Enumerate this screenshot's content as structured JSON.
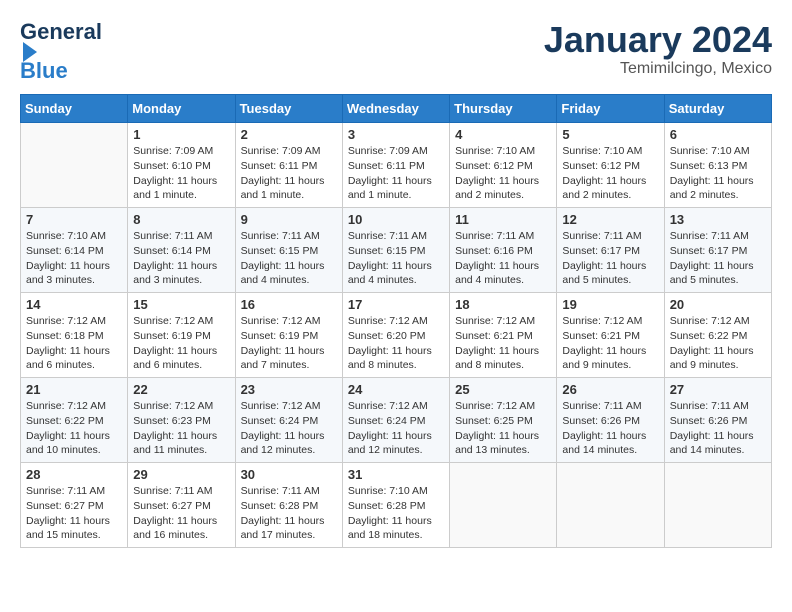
{
  "header": {
    "logo_line1": "General",
    "logo_line2": "Blue",
    "month_title": "January 2024",
    "location": "Temimilcingo, Mexico"
  },
  "days_of_week": [
    "Sunday",
    "Monday",
    "Tuesday",
    "Wednesday",
    "Thursday",
    "Friday",
    "Saturday"
  ],
  "weeks": [
    [
      {
        "day": "",
        "info": ""
      },
      {
        "day": "1",
        "info": "Sunrise: 7:09 AM\nSunset: 6:10 PM\nDaylight: 11 hours\nand 1 minute."
      },
      {
        "day": "2",
        "info": "Sunrise: 7:09 AM\nSunset: 6:11 PM\nDaylight: 11 hours\nand 1 minute."
      },
      {
        "day": "3",
        "info": "Sunrise: 7:09 AM\nSunset: 6:11 PM\nDaylight: 11 hours\nand 1 minute."
      },
      {
        "day": "4",
        "info": "Sunrise: 7:10 AM\nSunset: 6:12 PM\nDaylight: 11 hours\nand 2 minutes."
      },
      {
        "day": "5",
        "info": "Sunrise: 7:10 AM\nSunset: 6:12 PM\nDaylight: 11 hours\nand 2 minutes."
      },
      {
        "day": "6",
        "info": "Sunrise: 7:10 AM\nSunset: 6:13 PM\nDaylight: 11 hours\nand 2 minutes."
      }
    ],
    [
      {
        "day": "7",
        "info": "Sunrise: 7:10 AM\nSunset: 6:14 PM\nDaylight: 11 hours\nand 3 minutes."
      },
      {
        "day": "8",
        "info": "Sunrise: 7:11 AM\nSunset: 6:14 PM\nDaylight: 11 hours\nand 3 minutes."
      },
      {
        "day": "9",
        "info": "Sunrise: 7:11 AM\nSunset: 6:15 PM\nDaylight: 11 hours\nand 4 minutes."
      },
      {
        "day": "10",
        "info": "Sunrise: 7:11 AM\nSunset: 6:15 PM\nDaylight: 11 hours\nand 4 minutes."
      },
      {
        "day": "11",
        "info": "Sunrise: 7:11 AM\nSunset: 6:16 PM\nDaylight: 11 hours\nand 4 minutes."
      },
      {
        "day": "12",
        "info": "Sunrise: 7:11 AM\nSunset: 6:17 PM\nDaylight: 11 hours\nand 5 minutes."
      },
      {
        "day": "13",
        "info": "Sunrise: 7:11 AM\nSunset: 6:17 PM\nDaylight: 11 hours\nand 5 minutes."
      }
    ],
    [
      {
        "day": "14",
        "info": "Sunrise: 7:12 AM\nSunset: 6:18 PM\nDaylight: 11 hours\nand 6 minutes."
      },
      {
        "day": "15",
        "info": "Sunrise: 7:12 AM\nSunset: 6:19 PM\nDaylight: 11 hours\nand 6 minutes."
      },
      {
        "day": "16",
        "info": "Sunrise: 7:12 AM\nSunset: 6:19 PM\nDaylight: 11 hours\nand 7 minutes."
      },
      {
        "day": "17",
        "info": "Sunrise: 7:12 AM\nSunset: 6:20 PM\nDaylight: 11 hours\nand 8 minutes."
      },
      {
        "day": "18",
        "info": "Sunrise: 7:12 AM\nSunset: 6:21 PM\nDaylight: 11 hours\nand 8 minutes."
      },
      {
        "day": "19",
        "info": "Sunrise: 7:12 AM\nSunset: 6:21 PM\nDaylight: 11 hours\nand 9 minutes."
      },
      {
        "day": "20",
        "info": "Sunrise: 7:12 AM\nSunset: 6:22 PM\nDaylight: 11 hours\nand 9 minutes."
      }
    ],
    [
      {
        "day": "21",
        "info": "Sunrise: 7:12 AM\nSunset: 6:22 PM\nDaylight: 11 hours\nand 10 minutes."
      },
      {
        "day": "22",
        "info": "Sunrise: 7:12 AM\nSunset: 6:23 PM\nDaylight: 11 hours\nand 11 minutes."
      },
      {
        "day": "23",
        "info": "Sunrise: 7:12 AM\nSunset: 6:24 PM\nDaylight: 11 hours\nand 12 minutes."
      },
      {
        "day": "24",
        "info": "Sunrise: 7:12 AM\nSunset: 6:24 PM\nDaylight: 11 hours\nand 12 minutes."
      },
      {
        "day": "25",
        "info": "Sunrise: 7:12 AM\nSunset: 6:25 PM\nDaylight: 11 hours\nand 13 minutes."
      },
      {
        "day": "26",
        "info": "Sunrise: 7:11 AM\nSunset: 6:26 PM\nDaylight: 11 hours\nand 14 minutes."
      },
      {
        "day": "27",
        "info": "Sunrise: 7:11 AM\nSunset: 6:26 PM\nDaylight: 11 hours\nand 14 minutes."
      }
    ],
    [
      {
        "day": "28",
        "info": "Sunrise: 7:11 AM\nSunset: 6:27 PM\nDaylight: 11 hours\nand 15 minutes."
      },
      {
        "day": "29",
        "info": "Sunrise: 7:11 AM\nSunset: 6:27 PM\nDaylight: 11 hours\nand 16 minutes."
      },
      {
        "day": "30",
        "info": "Sunrise: 7:11 AM\nSunset: 6:28 PM\nDaylight: 11 hours\nand 17 minutes."
      },
      {
        "day": "31",
        "info": "Sunrise: 7:10 AM\nSunset: 6:28 PM\nDaylight: 11 hours\nand 18 minutes."
      },
      {
        "day": "",
        "info": ""
      },
      {
        "day": "",
        "info": ""
      },
      {
        "day": "",
        "info": ""
      }
    ]
  ]
}
